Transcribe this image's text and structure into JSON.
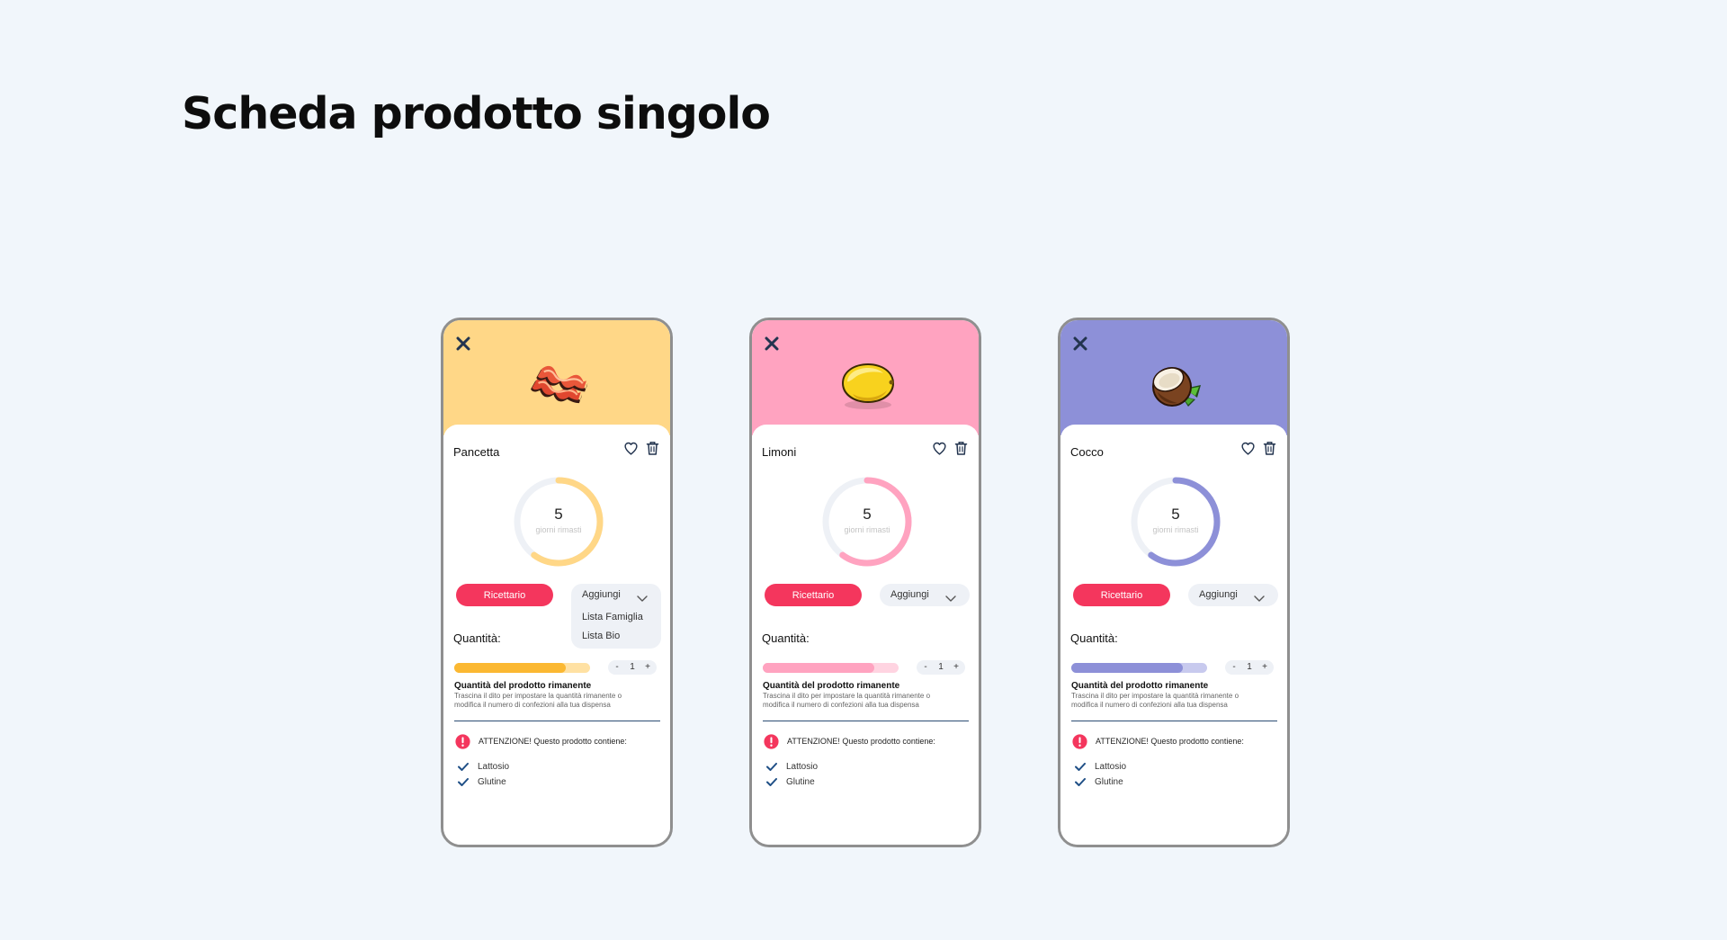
{
  "page": {
    "title": "Scheda prodotto singolo"
  },
  "products": [
    {
      "name": "Pancetta",
      "image": "bacon-image",
      "header_color": "#ffd787",
      "accent": "#ffd787",
      "slider_fill_color": "#fbb832",
      "slider_track_color": "#ffe1a3",
      "days_left": "5",
      "days_label": "giorni rimasti",
      "days_ring_fraction": 0.6,
      "recipes_label": "Ricettario",
      "add_label": "Aggiungi",
      "dropdown_open": true,
      "dropdown_options": [
        "Lista Famiglia",
        "Lista Bio"
      ],
      "quantity_label": "Quantità:",
      "remaining_fraction": 0.82,
      "stepper": {
        "minus": "-",
        "value": "1",
        "plus": "+"
      },
      "hint_title": "Quantità del prodotto rimanente",
      "hint_text": "Trascina il dito per impostare la quantità rimanente o modifica il numero di confezioni alla tua dispensa",
      "alert_text": "ATTENZIONE! Questo prodotto contiene:",
      "allergens": [
        "Lattosio",
        "Glutine"
      ]
    },
    {
      "name": "Limoni",
      "image": "lemon-image",
      "header_color": "#ffa3c0",
      "accent": "#ffa3c0",
      "slider_fill_color": "#ffa3c0",
      "slider_track_color": "#ffd4e1",
      "days_left": "5",
      "days_label": "giorni rimasti",
      "days_ring_fraction": 0.6,
      "recipes_label": "Ricettario",
      "add_label": "Aggiungi",
      "dropdown_open": false,
      "dropdown_options": [],
      "quantity_label": "Quantità:",
      "remaining_fraction": 0.82,
      "stepper": {
        "minus": "-",
        "value": "1",
        "plus": "+"
      },
      "hint_title": "Quantità del prodotto rimanente",
      "hint_text": "Trascina il dito per impostare la quantità rimanente o modifica il numero di confezioni alla tua dispensa",
      "alert_text": "ATTENZIONE! Questo prodotto contiene:",
      "allergens": [
        "Lattosio",
        "Glutine"
      ]
    },
    {
      "name": "Cocco",
      "image": "coconut-image",
      "header_color": "#8d90d8",
      "accent": "#8d90d8",
      "slider_fill_color": "#8d90d8",
      "slider_track_color": "#c8caee",
      "days_left": "5",
      "days_label": "giorni rimasti",
      "days_ring_fraction": 0.6,
      "recipes_label": "Ricettario",
      "add_label": "Aggiungi",
      "dropdown_open": false,
      "dropdown_options": [],
      "quantity_label": "Quantità:",
      "remaining_fraction": 0.82,
      "stepper": {
        "minus": "-",
        "value": "1",
        "plus": "+"
      },
      "hint_title": "Quantità del prodotto rimanente",
      "hint_text": "Trascina il dito per impostare la quantità rimanente o modifica il numero di confezioni alla tua dispensa",
      "alert_text": "ATTENZIONE! Questo prodotto contiene:",
      "allergens": [
        "Lattosio",
        "Glutine"
      ]
    }
  ],
  "colors": {
    "background": "#f1f6fb",
    "primary_button": "#f4365d",
    "icon_dark": "#23344f",
    "divider": "#2c4d73",
    "check": "#1f4f86",
    "ring_track": "#eef1f6"
  }
}
